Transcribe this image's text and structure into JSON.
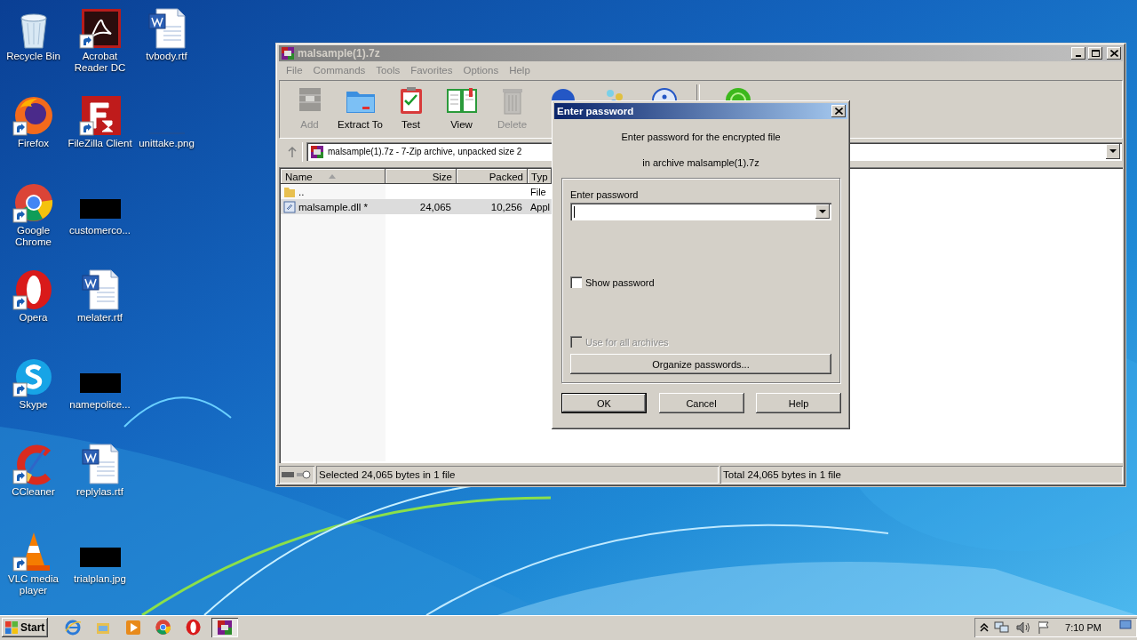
{
  "desktop": {
    "icon_columns": [
      {
        "icons": [
          {
            "label": "Recycle Bin",
            "kind": "recycle",
            "shortcut": false
          },
          {
            "label": "Firefox",
            "kind": "firefox",
            "shortcut": true
          },
          {
            "label": "Google Chrome",
            "kind": "chrome",
            "shortcut": true
          },
          {
            "label": "Opera",
            "kind": "opera",
            "shortcut": true
          },
          {
            "label": "Skype",
            "kind": "skype",
            "shortcut": true
          },
          {
            "label": "CCleaner",
            "kind": "ccleaner",
            "shortcut": true
          },
          {
            "label": "VLC media player",
            "kind": "vlc",
            "shortcut": true
          }
        ]
      },
      {
        "icons": [
          {
            "label": "Acrobat Reader DC",
            "kind": "acrobat",
            "shortcut": true
          },
          {
            "label": "FileZilla Client",
            "kind": "filezilla",
            "shortcut": true
          },
          {
            "label": "customerco...",
            "kind": "redacted",
            "shortcut": false
          },
          {
            "label": "melater.rtf",
            "kind": "word",
            "shortcut": false
          },
          {
            "label": "namepolice...",
            "kind": "redacted",
            "shortcut": false
          },
          {
            "label": "replylas.rtf",
            "kind": "word",
            "shortcut": false
          },
          {
            "label": "trialplan.jpg",
            "kind": "redacted",
            "shortcut": false
          }
        ]
      },
      {
        "icons": [
          {
            "label": "tvbody.rtf",
            "kind": "word",
            "shortcut": false
          },
          {
            "label": "unittake.png",
            "kind": "blank",
            "shortcut": false
          }
        ]
      }
    ]
  },
  "archive_window": {
    "title": "malsample(1).7z",
    "menu": [
      "File",
      "Commands",
      "Tools",
      "Favorites",
      "Options",
      "Help"
    ],
    "toolbar": [
      {
        "label": "Add",
        "kind": "add",
        "disabled": true
      },
      {
        "label": "Extract To",
        "kind": "extract",
        "disabled": false
      },
      {
        "label": "Test",
        "kind": "test",
        "disabled": false
      },
      {
        "label": "View",
        "kind": "view",
        "disabled": false
      },
      {
        "label": "Delete",
        "kind": "delete",
        "disabled": true
      }
    ],
    "address": "malsample(1).7z - 7-Zip archive, unpacked size 2",
    "columns": [
      {
        "label": "Name",
        "sorted": true
      },
      {
        "label": "Size",
        "sorted": false
      },
      {
        "label": "Packed",
        "sorted": false
      },
      {
        "label": "Typ",
        "sorted": false
      }
    ],
    "rows": [
      {
        "kind": "folder",
        "name": "..",
        "type": "File",
        "selected": false
      },
      {
        "kind": "file",
        "name": "malsample.dll *",
        "size": "24,065",
        "packed": "10,256",
        "type": "Appl",
        "selected": true
      }
    ],
    "status_bar": [
      "Selected 24,065 bytes in 1 file",
      "Total 24,065 bytes in 1 file"
    ]
  },
  "password_dialog": {
    "title": "Enter password",
    "message": [
      "Enter password for the encrypted file",
      "in archive malsample(1).7z"
    ],
    "field_label": "Enter password",
    "checkboxes": [
      {
        "label": "Show password",
        "checked": false,
        "disabled": false
      },
      {
        "label": "Use for all archives",
        "checked": false,
        "disabled": true
      }
    ],
    "organize_button": "Organize passwords...",
    "buttons": [
      {
        "label": "OK",
        "default": true
      },
      {
        "label": "Cancel",
        "default": false
      },
      {
        "label": "Help",
        "default": false
      }
    ]
  },
  "taskbar": {
    "start": "Start",
    "apps": [
      {
        "kind": "ie",
        "active": false
      },
      {
        "kind": "explorer",
        "active": false
      },
      {
        "kind": "media",
        "active": false
      },
      {
        "kind": "chrome",
        "active": false
      },
      {
        "kind": "opera",
        "active": false
      },
      {
        "kind": "sevenzip",
        "active": true
      }
    ],
    "clock": "7:10 PM"
  }
}
